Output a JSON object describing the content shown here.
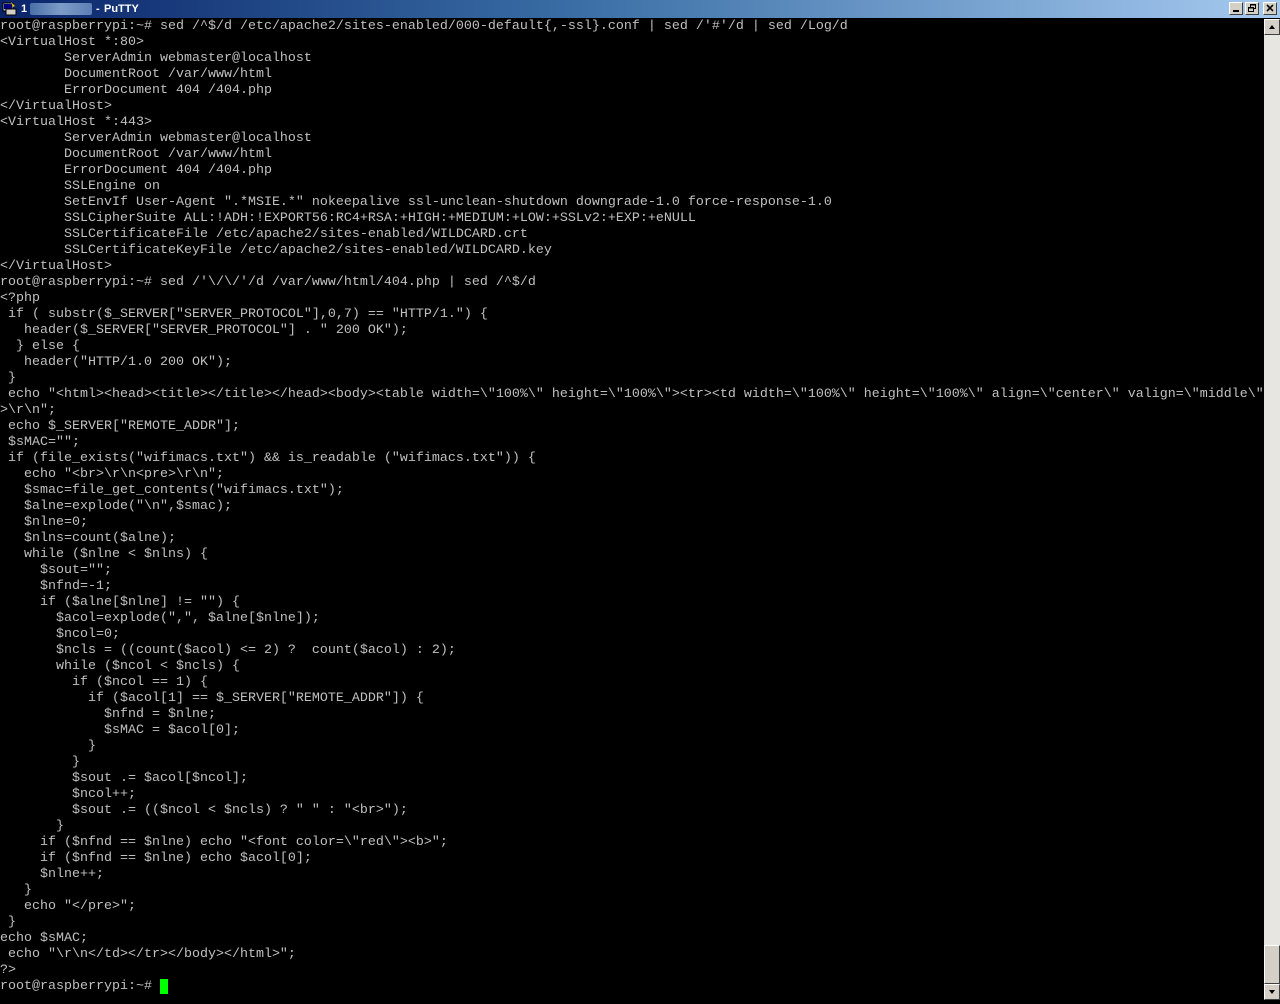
{
  "window": {
    "title_prefix": "1",
    "title_separator": "-",
    "title_app": "PuTTY",
    "icon": "putty-terminal-icon"
  },
  "controls": {
    "minimize": "minimize-icon",
    "maximize": "restore-icon",
    "close": "close-icon"
  },
  "terminal": {
    "foreground": "#c0c0c0",
    "background": "#000000",
    "cursor_color": "#00ff00",
    "lines": [
      "root@raspberrypi:~# sed /^$/d /etc/apache2/sites-enabled/000-default{,-ssl}.conf | sed /'#'/d | sed /Log/d",
      "<VirtualHost *:80>",
      "        ServerAdmin webmaster@localhost",
      "        DocumentRoot /var/www/html",
      "        ErrorDocument 404 /404.php",
      "</VirtualHost>",
      "<VirtualHost *:443>",
      "        ServerAdmin webmaster@localhost",
      "        DocumentRoot /var/www/html",
      "        ErrorDocument 404 /404.php",
      "        SSLEngine on",
      "        SetEnvIf User-Agent \".*MSIE.*\" nokeepalive ssl-unclean-shutdown downgrade-1.0 force-response-1.0",
      "        SSLCipherSuite ALL:!ADH:!EXPORT56:RC4+RSA:+HIGH:+MEDIUM:+LOW:+SSLv2:+EXP:+eNULL",
      "        SSLCertificateFile /etc/apache2/sites-enabled/WILDCARD.crt",
      "        SSLCertificateKeyFile /etc/apache2/sites-enabled/WILDCARD.key",
      "</VirtualHost>",
      "root@raspberrypi:~# sed /'\\/\\/'/d /var/www/html/404.php | sed /^$/d",
      "<?php",
      " if ( substr($_SERVER[\"SERVER_PROTOCOL\"],0,7) == \"HTTP/1.\") {",
      "   header($_SERVER[\"SERVER_PROTOCOL\"] . \" 200 OK\");",
      "  } else {",
      "   header(\"HTTP/1.0 200 OK\");",
      " }",
      " echo \"<html><head><title></title></head><body><table width=\\\"100%\\\" height=\\\"100%\\\"><tr><td width=\\\"100%\\\" height=\\\"100%\\\" align=\\\"center\\\" valign=\\\"middle\\\"",
      ">\\r\\n\";",
      " echo $_SERVER[\"REMOTE_ADDR\"];",
      " $sMAC=\"\";",
      " if (file_exists(\"wifimacs.txt\") && is_readable (\"wifimacs.txt\")) {",
      "   echo \"<br>\\r\\n<pre>\\r\\n\";",
      "   $smac=file_get_contents(\"wifimacs.txt\");",
      "   $alne=explode(\"\\n\",$smac);",
      "   $nlne=0;",
      "   $nlns=count($alne);",
      "   while ($nlne < $nlns) {",
      "     $sout=\"\";",
      "     $nfnd=-1;",
      "     if ($alne[$nlne] != \"\") {",
      "       $acol=explode(\",\", $alne[$nlne]);",
      "       $ncol=0;",
      "       $ncls = ((count($acol) <= 2) ?  count($acol) : 2);",
      "       while ($ncol < $ncls) {",
      "         if ($ncol == 1) {",
      "           if ($acol[1] == $_SERVER[\"REMOTE_ADDR\"]) {",
      "             $nfnd = $nlne;",
      "             $sMAC = $acol[0];",
      "           }",
      "         }",
      "         $sout .= $acol[$ncol];",
      "         $ncol++;",
      "         $sout .= (($ncol < $ncls) ? \" \" : \"<br>\");",
      "       }",
      "     if ($nfnd == $nlne) echo \"<font color=\\\"red\\\"><b>\";",
      "     if ($nfnd == $nlne) echo $acol[0];",
      "     $nlne++;",
      "   }",
      "   echo \"</pre>\";",
      " }",
      "echo $sMAC;",
      " echo \"\\r\\n</td></tr></body></html>\";",
      "?>",
      "root@raspberrypi:~# "
    ]
  },
  "scrollbar": {
    "up_arrow": "scroll-up-arrow-icon",
    "down_arrow": "scroll-down-arrow-icon",
    "position_fraction": 0.97
  }
}
